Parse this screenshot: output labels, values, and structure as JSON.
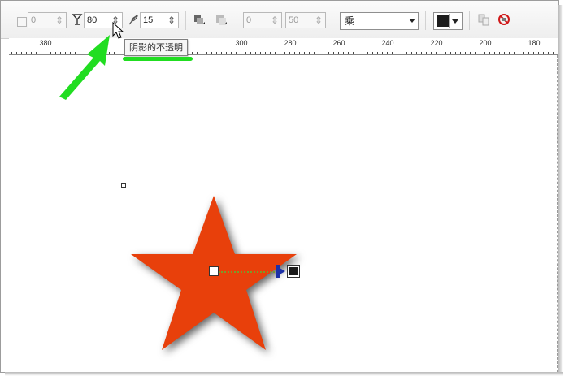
{
  "toolbar": {
    "offset_x": "0",
    "opacity": "80",
    "feather": "15",
    "stretch": "0",
    "fade": "50",
    "transparency_mode": "乘",
    "shadow_color": "#1c1c1c"
  },
  "tooltip": {
    "text": "阴影的不透明"
  },
  "ruler": {
    "labels": [
      "380",
      "300",
      "280",
      "260",
      "240",
      "220",
      "200",
      "180"
    ]
  },
  "canvas": {
    "star_color": "#e8400b",
    "annotation_color": "#21dd21"
  }
}
